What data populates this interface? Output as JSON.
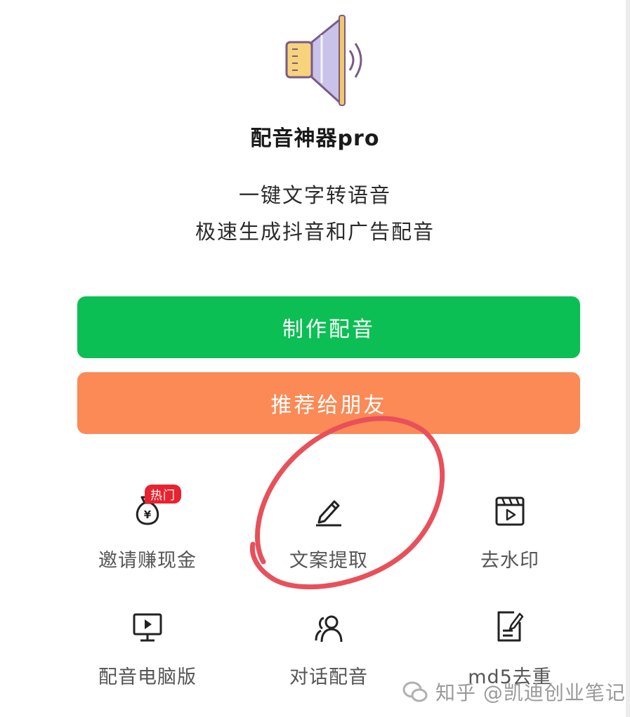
{
  "app": {
    "name": "配音神器pro",
    "slogan_line1": "一键文字转语音",
    "slogan_line2": "极速生成抖音和广告配音"
  },
  "buttons": {
    "make_dubbing": "制作配音",
    "share_friends": "推荐给朋友"
  },
  "features": [
    {
      "label": "邀请赚现金",
      "icon": "money-bag-icon",
      "badge": "热门"
    },
    {
      "label": "文案提取",
      "icon": "pencil-icon"
    },
    {
      "label": "去水印",
      "icon": "video-clapper-icon"
    },
    {
      "label": "配音电脑版",
      "icon": "monitor-icon"
    },
    {
      "label": "对话配音",
      "icon": "users-icon"
    },
    {
      "label": "md5去重",
      "icon": "document-edit-icon"
    }
  ],
  "watermark": {
    "text": "知乎 @凯迪创业笔记"
  },
  "colors": {
    "primary_green": "#0bbf54",
    "share_orange": "#fb8a56",
    "badge_red": "#e8222e",
    "annotation_red": "#e8505a"
  }
}
